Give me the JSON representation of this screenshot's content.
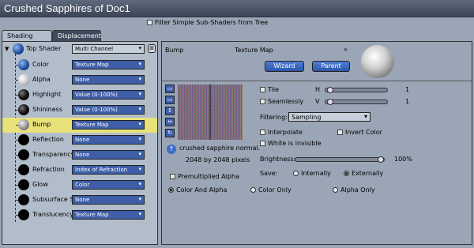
{
  "window": {
    "title": "Crushed Sapphires of Doc1"
  },
  "filter": {
    "label": "Filter Simple Sub-Shaders from Tree",
    "checked": false
  },
  "tabs": [
    {
      "label": "Shading",
      "active": true
    },
    {
      "label": "Displacement",
      "active": false
    }
  ],
  "tree": {
    "top": {
      "label": "Top Shader",
      "value": "Multi Channel"
    },
    "channels": [
      {
        "label": "Color",
        "value": "Texture Map",
        "ball": "blue-icon"
      },
      {
        "label": "Alpha",
        "value": "None",
        "ball": "white-icon"
      },
      {
        "label": "Highlight",
        "value": "Value (0-100%)",
        "ball": "black-icon"
      },
      {
        "label": "Shininess",
        "value": "Value (0-100%)",
        "ball": "black-icon"
      },
      {
        "label": "Bump",
        "value": "Texture Map",
        "ball": "gray-icon",
        "selected": true
      },
      {
        "label": "Reflection",
        "value": "None",
        "ball": "black-icon"
      },
      {
        "label": "Transparency",
        "value": "None",
        "ball": "black-icon"
      },
      {
        "label": "Refraction",
        "value": "Index of Refraction",
        "ball": "black-icon"
      },
      {
        "label": "Glow",
        "value": "Color",
        "ball": "black-icon"
      },
      {
        "label": "Subsurface Sc",
        "value": "None",
        "ball": "black-icon"
      },
      {
        "label": "Translucency",
        "value": "Texture Map",
        "ball": "black-icon"
      }
    ]
  },
  "editor": {
    "channel": "Bump",
    "shader_type": "Texture Map",
    "collapse_glyph": "»",
    "wizard_label": "Wizard",
    "parent_label": "Parent",
    "file_name": "crushed sapphire normal.",
    "file_size": "2048 by 2048 pixels",
    "tile_label": "Tile",
    "seamlessly_label": "Seamlessly",
    "h_label": "H",
    "v_label": "V",
    "h_value": "1",
    "v_value": "1",
    "filtering_label": "Filtering:",
    "filtering_value": "Sampling",
    "interpolate_label": "Interpolate",
    "invert_label": "Invert Color",
    "white_invisible_label": "White is invisible",
    "brightness_label": "Brightness:",
    "brightness_value": "100%",
    "save_label": "Save:",
    "internally_label": "Internally",
    "externally_label": "Externally",
    "save_choice": "Externally",
    "premultiplied_label": "Premultiplied Alpha",
    "color_alpha_label": "Color And Alpha",
    "color_only_label": "Color Only",
    "alpha_only_label": "Alpha Only",
    "mode_choice": "Color And Alpha"
  }
}
